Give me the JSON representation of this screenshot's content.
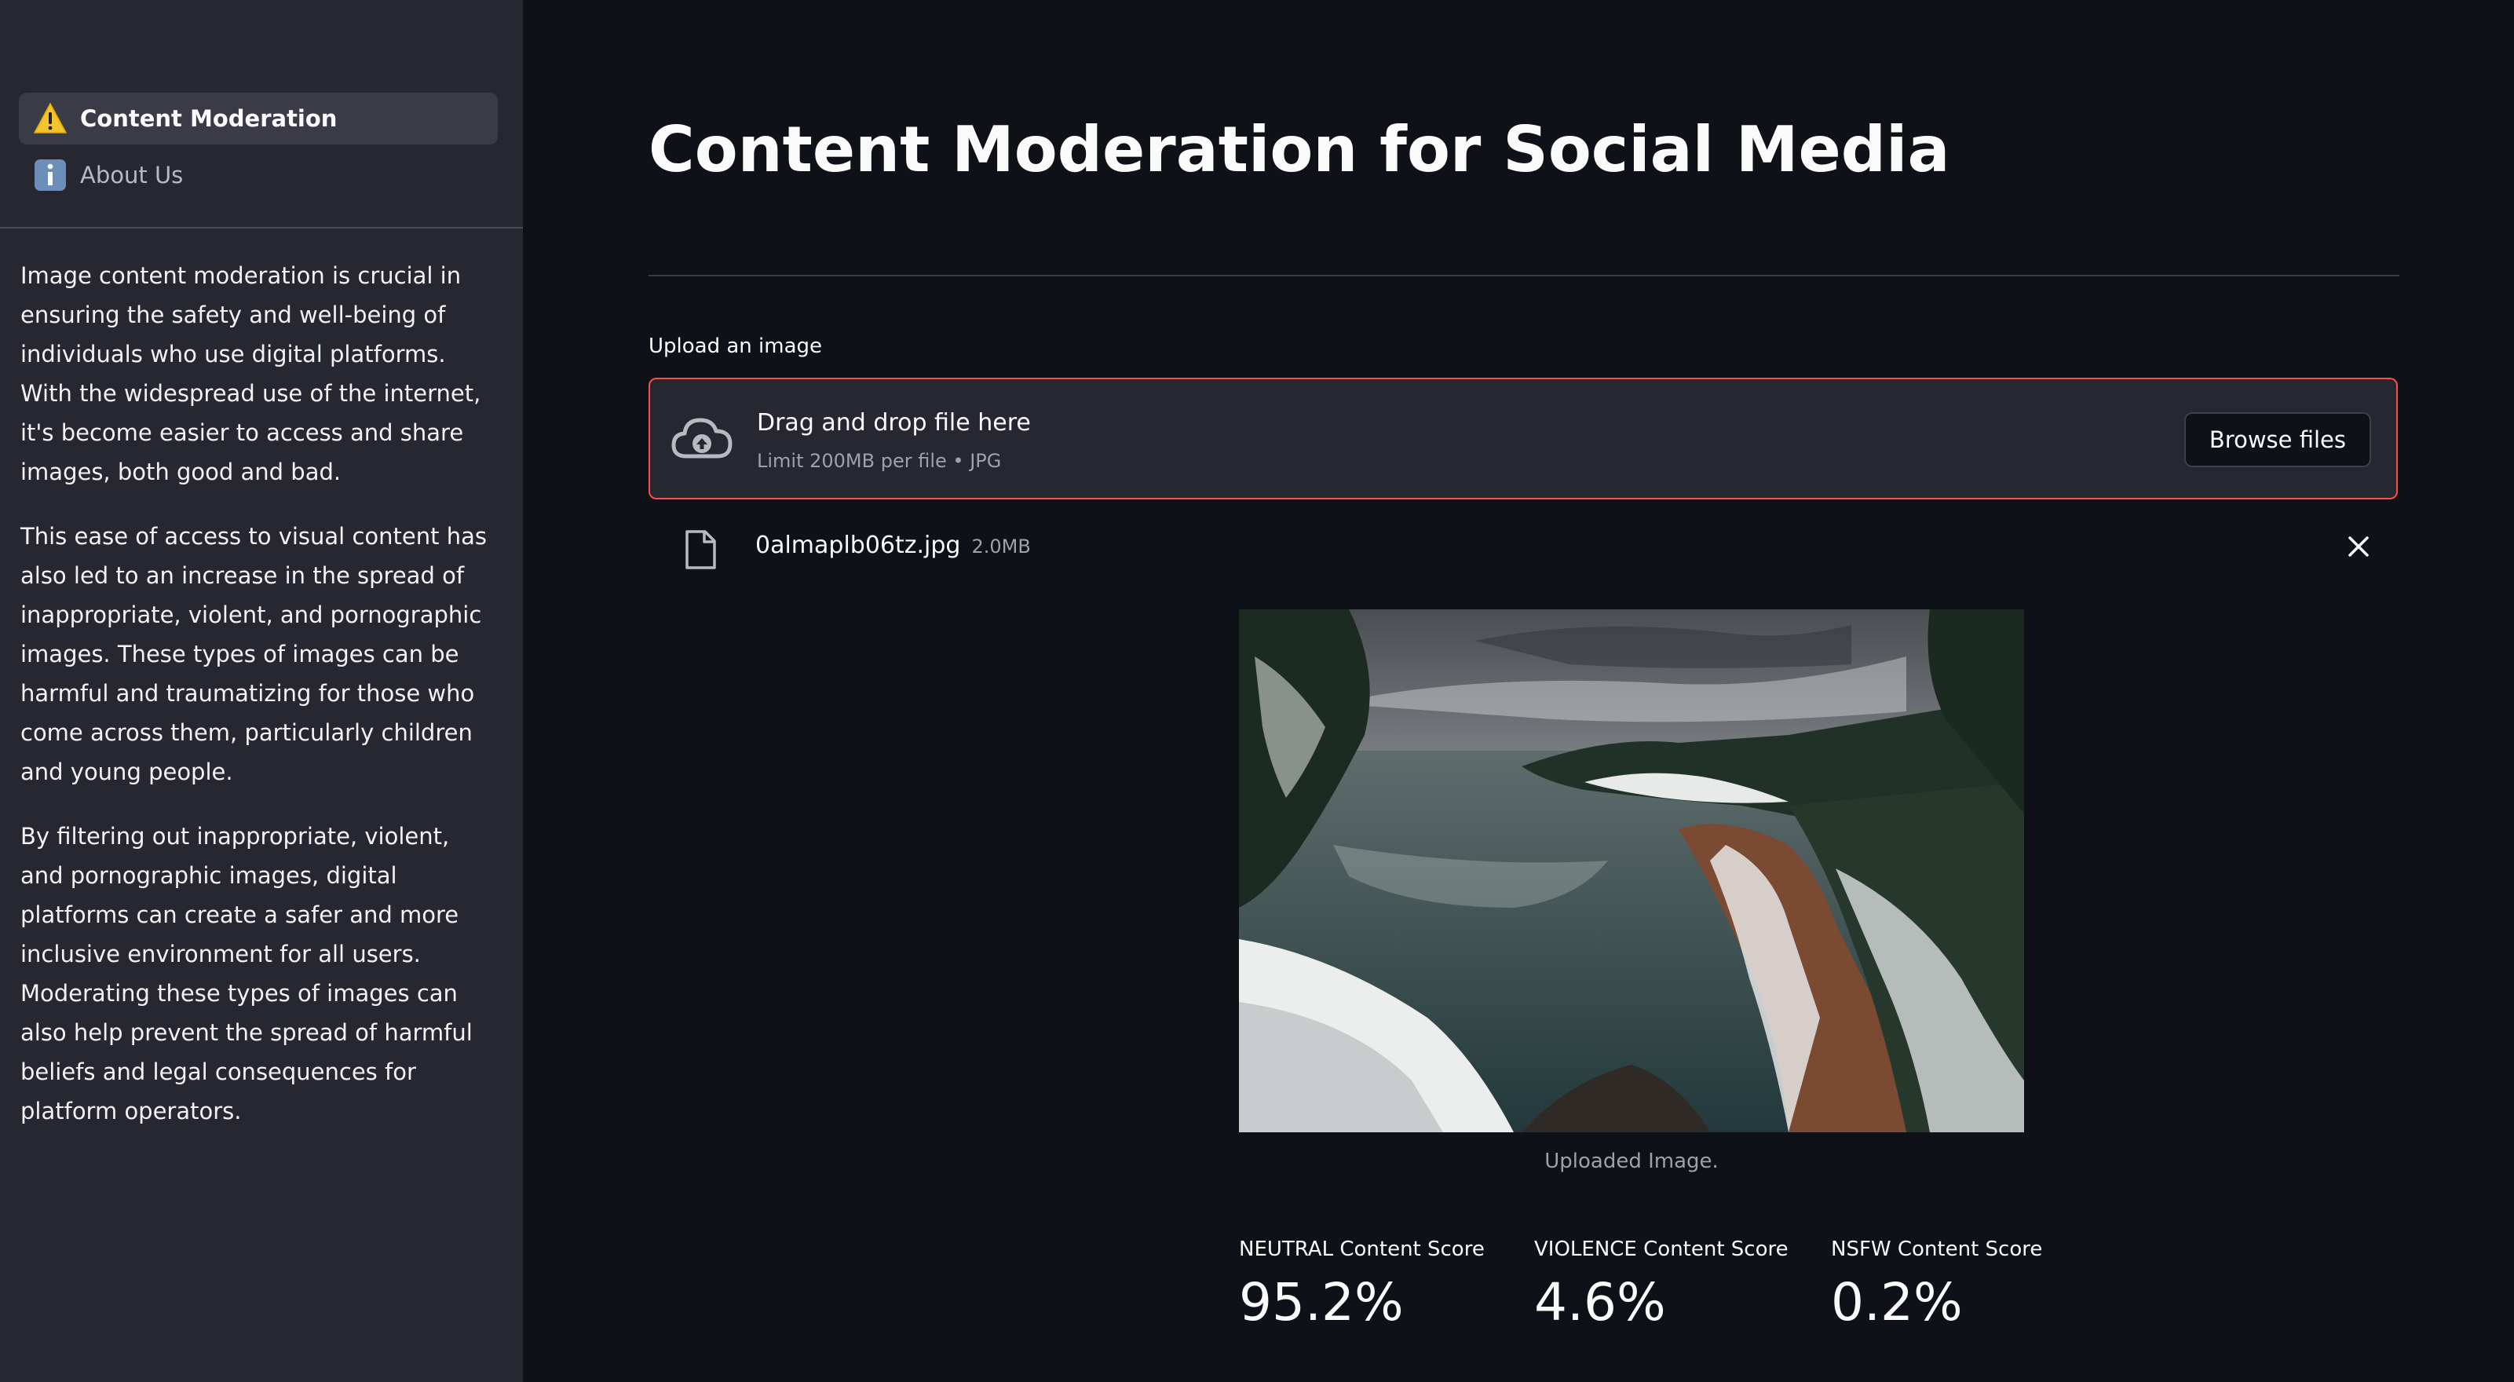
{
  "sidebar": {
    "nav": [
      {
        "label": "Content Moderation",
        "icon": "warning-icon",
        "active": true
      },
      {
        "label": "About Us",
        "icon": "info-icon",
        "active": false
      }
    ],
    "paragraphs": [
      "Image content moderation is crucial in ensuring the safety and well-being of individuals who use digital platforms. With the widespread use of the internet, it's become easier to access and share images, both good and bad.",
      "This ease of access to visual content has also led to an increase in the spread of inappropriate, violent, and pornographic images. These types of images can be harmful and traumatizing for those who come across them, particularly children and young people.",
      "By filtering out inappropriate, violent, and pornographic images, digital platforms can create a safer and more inclusive environment for all users. Moderating these types of images can also help prevent the spread of harmful beliefs and legal consequences for platform operators."
    ]
  },
  "main": {
    "title": "Content Moderation for Social Media",
    "uploader": {
      "label": "Upload an image",
      "drop_text": "Drag and drop file here",
      "limit_text": "Limit 200MB per file • JPG",
      "browse_label": "Browse files",
      "icon": "cloud-upload-icon"
    },
    "file": {
      "name": "0almaplb06tz.jpg",
      "size": "2.0MB",
      "icon": "file-icon"
    },
    "image": {
      "caption": "Uploaded Image."
    },
    "metrics": [
      {
        "label": "NEUTRAL Content Score",
        "value": "95.2%"
      },
      {
        "label": "VIOLENCE Content Score",
        "value": "4.6%"
      },
      {
        "label": "NSFW Content Score",
        "value": "0.2%"
      }
    ]
  },
  "colors": {
    "background": "#0e1117",
    "sidebar": "#262730",
    "accent_border": "#ff4b4b",
    "text": "#fafafa",
    "muted_text": "#9fa1aa"
  }
}
